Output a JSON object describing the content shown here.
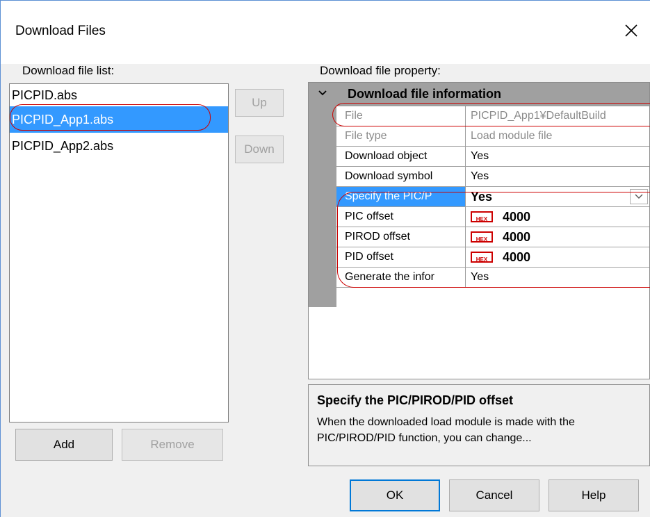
{
  "window": {
    "title": "Download Files",
    "close_label": "×"
  },
  "file_list": {
    "label": "Download file list:",
    "items": [
      {
        "label": "PICPID.abs",
        "selected": false
      },
      {
        "label": "PICPID_App1.abs",
        "selected": true
      },
      {
        "label": "PICPID_App2.abs",
        "selected": false
      }
    ]
  },
  "list_buttons": {
    "up": "Up",
    "down": "Down",
    "add": "Add",
    "remove": "Remove"
  },
  "property": {
    "label": "Download file property:",
    "category": "Download file information",
    "rows": [
      {
        "name": "File",
        "value": "PICPID_App1¥DefaultBuild"
      },
      {
        "name": "File type",
        "value": "Load module file"
      },
      {
        "name": "Download object",
        "value": "Yes"
      },
      {
        "name": "Download symbol",
        "value": "Yes"
      },
      {
        "name": "Specify the PIC/P",
        "value": "Yes"
      },
      {
        "name": "PIC offset",
        "value": "4000",
        "badge": "HEX"
      },
      {
        "name": "PIROD offset",
        "value": "4000",
        "badge": "HEX"
      },
      {
        "name": "PID offset",
        "value": "4000",
        "badge": "HEX"
      },
      {
        "name": "Generate the infor",
        "value": "Yes"
      }
    ]
  },
  "description": {
    "title": "Specify the PIC/PIROD/PID offset",
    "body": "When the downloaded load module is made with the PIC/PIROD/PID function, you can change..."
  },
  "footer": {
    "ok": "OK",
    "cancel": "Cancel",
    "help": "Help"
  },
  "colors": {
    "selection": "#3399ff",
    "annotation": "#cc0000",
    "hex_badge": "#cc0000"
  }
}
